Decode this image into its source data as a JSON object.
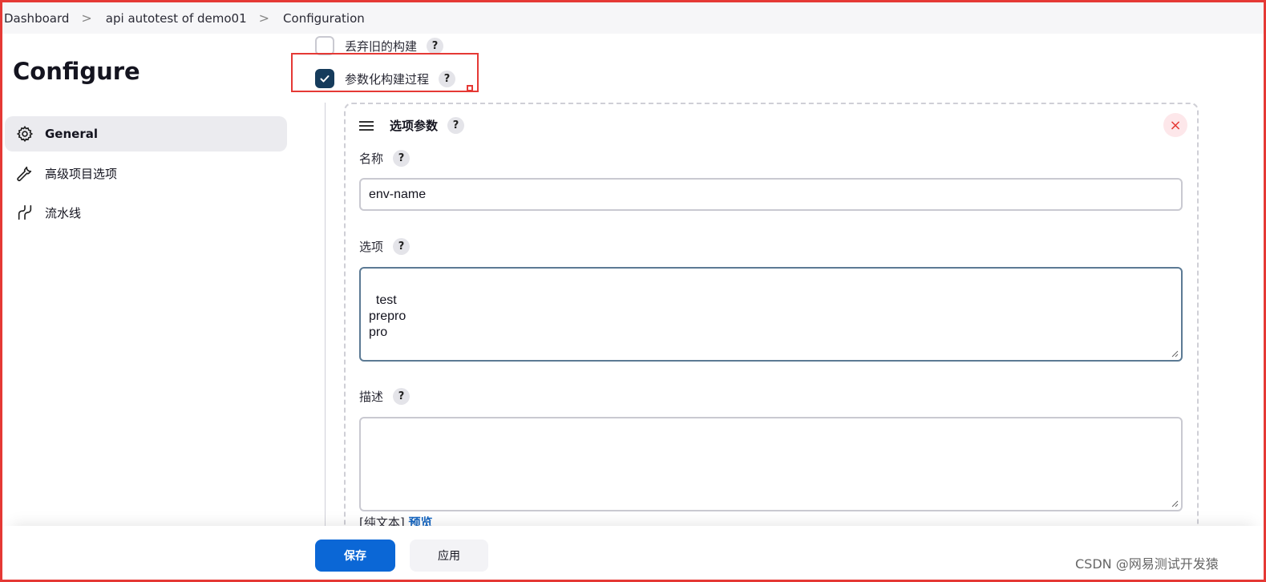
{
  "breadcrumb": {
    "items": [
      "Dashboard",
      "api autotest of demo01",
      "Configuration"
    ],
    "separator": ">"
  },
  "page_title": "Configure",
  "sidebar": {
    "items": [
      {
        "label": "General",
        "icon": "gear-icon",
        "active": true
      },
      {
        "label": "高级项目选项",
        "icon": "wrench-icon",
        "active": false
      },
      {
        "label": "流水线",
        "icon": "pipeline-icon",
        "active": false
      }
    ]
  },
  "options": {
    "discard_old_builds": {
      "label": "丢弃旧的构建",
      "checked": false
    },
    "parameterized": {
      "label": "参数化构建过程",
      "checked": true
    }
  },
  "help_symbol": "?",
  "choice_param": {
    "title": "选项参数",
    "close_symbol": "×",
    "name_label": "名称",
    "name_value": "env-name",
    "choices_label": "选项",
    "choices_value": "test\nprepro\npro",
    "description_label": "描述",
    "description_value": "",
    "hint_prefix": "[纯文本]",
    "preview_link": "预览"
  },
  "actions": {
    "save": "保存",
    "apply": "应用"
  },
  "watermark": "CSDN @网易测试开发猿",
  "colors": {
    "primary": "#0b67d6",
    "checkbox_checked": "#163c5c",
    "annotation_red": "#e53935"
  }
}
